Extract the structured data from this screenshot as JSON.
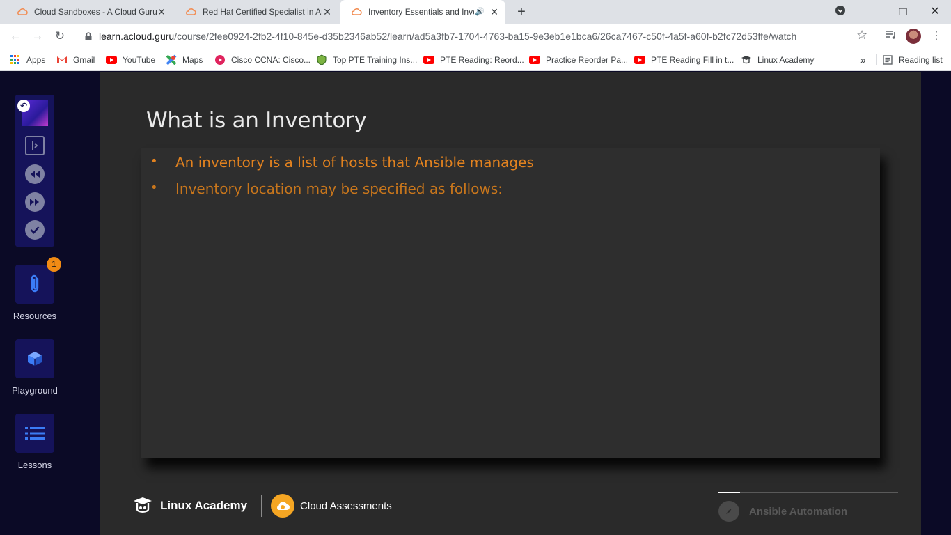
{
  "browser": {
    "tabs": [
      {
        "label": "Cloud Sandboxes - A Cloud Guru",
        "active": false
      },
      {
        "label": "Red Hat Certified Specialist in An",
        "active": false
      },
      {
        "label": "Inventory Essentials and Inve",
        "active": true,
        "audio": true
      }
    ],
    "url_host": "learn.acloud.guru",
    "url_path": "/course/2fee0924-2fb2-4f10-845e-d35b2346ab52/learn/ad5a3fb7-1704-4763-ba15-9e3eb1e1bca6/26ca7467-c50f-4a5f-a60f-b2fc72d53ffe/watch",
    "bookmarks": [
      {
        "label": "Apps",
        "icon": "apps-grid-icon"
      },
      {
        "label": "Gmail",
        "icon": "gmail-icon"
      },
      {
        "label": "YouTube",
        "icon": "youtube-icon"
      },
      {
        "label": "Maps",
        "icon": "maps-icon"
      },
      {
        "label": "Cisco CCNA: Cisco...",
        "icon": "cisco-icon"
      },
      {
        "label": "Top PTE Training Ins...",
        "icon": "pte-icon"
      },
      {
        "label": "PTE Reading: Reord...",
        "icon": "youtube-icon"
      },
      {
        "label": "Practice Reorder Pa...",
        "icon": "youtube-icon"
      },
      {
        "label": "PTE Reading Fill in t...",
        "icon": "youtube-icon"
      },
      {
        "label": "Linux Academy",
        "icon": "linux-academy-icon"
      }
    ],
    "bookmarks_overflow": "»",
    "reading_list": "Reading list"
  },
  "sidebar": {
    "resources_label": "Resources",
    "resources_badge": "1",
    "playground_label": "Playground",
    "lessons_label": "Lessons"
  },
  "slide": {
    "title": "What is an Inventory",
    "bullets": [
      "An inventory is a list of hosts that Ansible manages",
      "Inventory location may be specified as follows:"
    ],
    "brand_left": "Linux Academy",
    "brand_right": "Cloud Assessments",
    "course_name": "Ansible Automation",
    "progress_fraction": 0.12
  },
  "colors": {
    "accent_orange": "#e2821f",
    "sidebar_bg": "#0b0a26",
    "panel_bg": "#15135a"
  }
}
